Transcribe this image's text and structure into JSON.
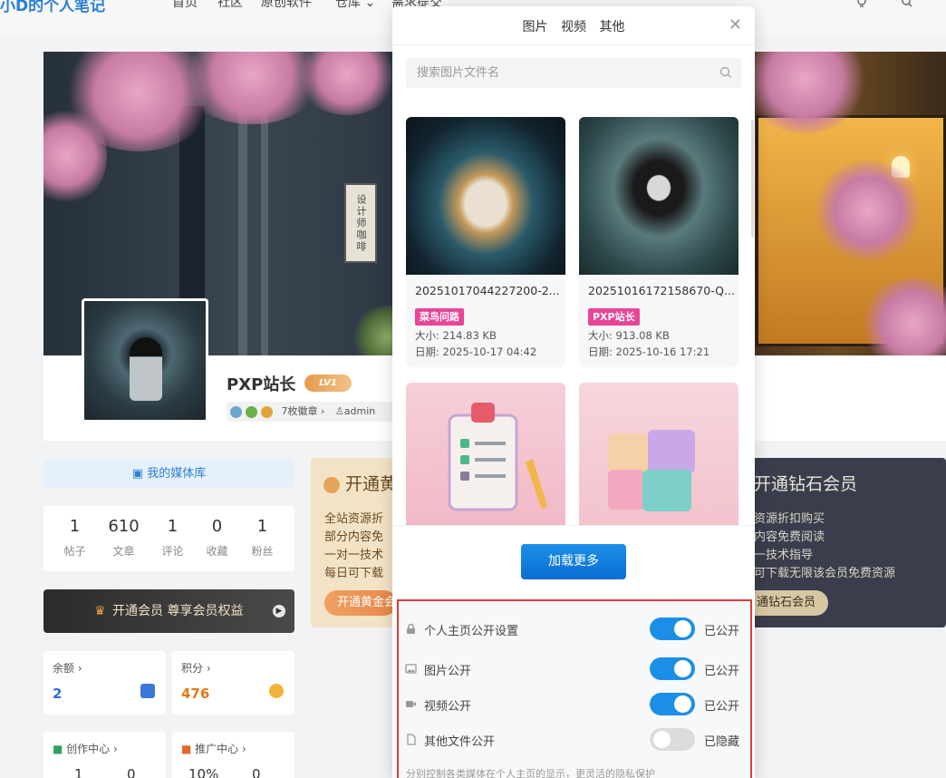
{
  "nav": {
    "logo": "小D的个人笔记",
    "links": [
      "首页",
      "社区",
      "原创软件",
      "仓库 ⌄",
      "需求提交"
    ]
  },
  "banner": {
    "sign_text": "设计师咖啡"
  },
  "profile": {
    "name": "PXP站长",
    "level": "LV1",
    "medals_label": "7枚徽章 ›",
    "role": "admin"
  },
  "left": {
    "media_tab": "我的媒体库",
    "stats": [
      {
        "num": "1",
        "label": "帖子"
      },
      {
        "num": "610",
        "label": "文章"
      },
      {
        "num": "1",
        "label": "评论"
      },
      {
        "num": "0",
        "label": "收藏"
      },
      {
        "num": "1",
        "label": "粉丝"
      }
    ],
    "vip_bar": "开通会员 尊享会员权益",
    "balance": {
      "label": "余额 ›",
      "value": "2"
    },
    "points": {
      "label": "积分 ›",
      "value": "476"
    },
    "creator": {
      "label": "创作中心 ›",
      "a": "1",
      "b": "0"
    },
    "promo_center": {
      "label": "推广中心 ›",
      "a": "10%",
      "b": "0"
    }
  },
  "promo_gold": {
    "title": "开通黄",
    "lines": [
      "全站资源折",
      "部分内容免",
      "一对一技术",
      "每日可下载"
    ],
    "button": "开通黄金会"
  },
  "promo_diamond": {
    "title": "开通钻石会员",
    "lines": [
      "资源折扣购买",
      "内容免费阅读",
      "一技术指导",
      "可下载无限该会员免费资源"
    ],
    "button": "通钻石会员"
  },
  "modal": {
    "tabs": [
      "图片",
      "视频",
      "其他"
    ],
    "search_placeholder": "搜索图片文件名",
    "items": [
      {
        "filename": "20251017044227200-2...",
        "tag": "菜鸟问路",
        "size": "大小: 214.83 KB",
        "date": "日期: 2025-10-17 04:42"
      },
      {
        "filename": "20251016172158670-Q...",
        "tag": "PXP站长",
        "size": "大小: 913.08 KB",
        "date": "日期: 2025-10-16 17:21"
      }
    ],
    "load_more": "加载更多",
    "privacy": {
      "rows": [
        {
          "label": "个人主页公开设置",
          "state": "已公开",
          "on": true,
          "icon": "lock-icon"
        },
        {
          "label": "图片公开",
          "state": "已公开",
          "on": true,
          "icon": "image-icon"
        },
        {
          "label": "视频公开",
          "state": "已公开",
          "on": true,
          "icon": "video-icon"
        },
        {
          "label": "其他文件公开",
          "state": "已隐藏",
          "on": false,
          "icon": "file-icon"
        }
      ],
      "note": "分别控制各类媒体在个人主页的显示，更灵活的隐私保护"
    }
  },
  "colors": {
    "accent": "#1b8fe8",
    "tag": "#e94596",
    "highlight_border": "#e03a3a"
  }
}
